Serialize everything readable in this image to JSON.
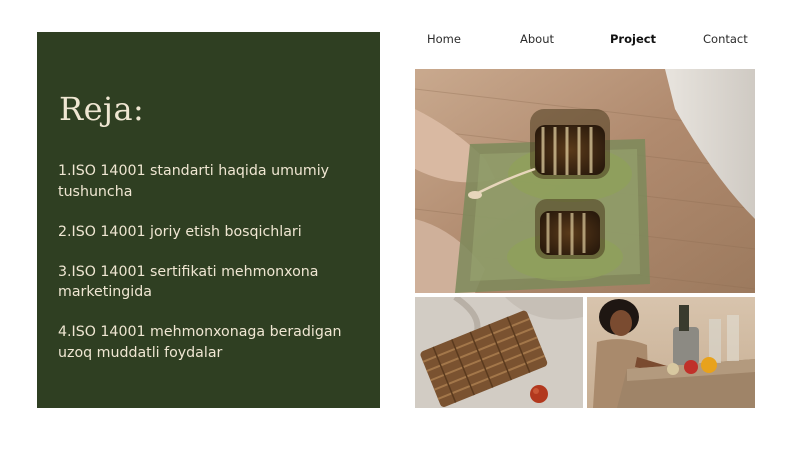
{
  "nav": {
    "items": [
      {
        "label": "Home",
        "active": false
      },
      {
        "label": "About",
        "active": false
      },
      {
        "label": "Project",
        "active": true
      },
      {
        "label": "Contact",
        "active": false
      }
    ]
  },
  "panel": {
    "title": "Reja:",
    "background": "#2f3f22",
    "text_color": "#efe6d2",
    "items": [
      "1.ISO 14001 standarti haqida umumiy tushuncha",
      "2.ISO 14001 joriy etish bosqichlari",
      "3.ISO 14001 sertifikati mehmonxona marketingida",
      "4.ISO 14001 mehmonxonaga beradigan uzoq muddatli foydalar"
    ]
  },
  "photos": {
    "main": "glass tea cups on a green tray",
    "bottom_left": "wicker basket on linen with a red apple",
    "bottom_right": "woman at a picnic table with fruit"
  }
}
